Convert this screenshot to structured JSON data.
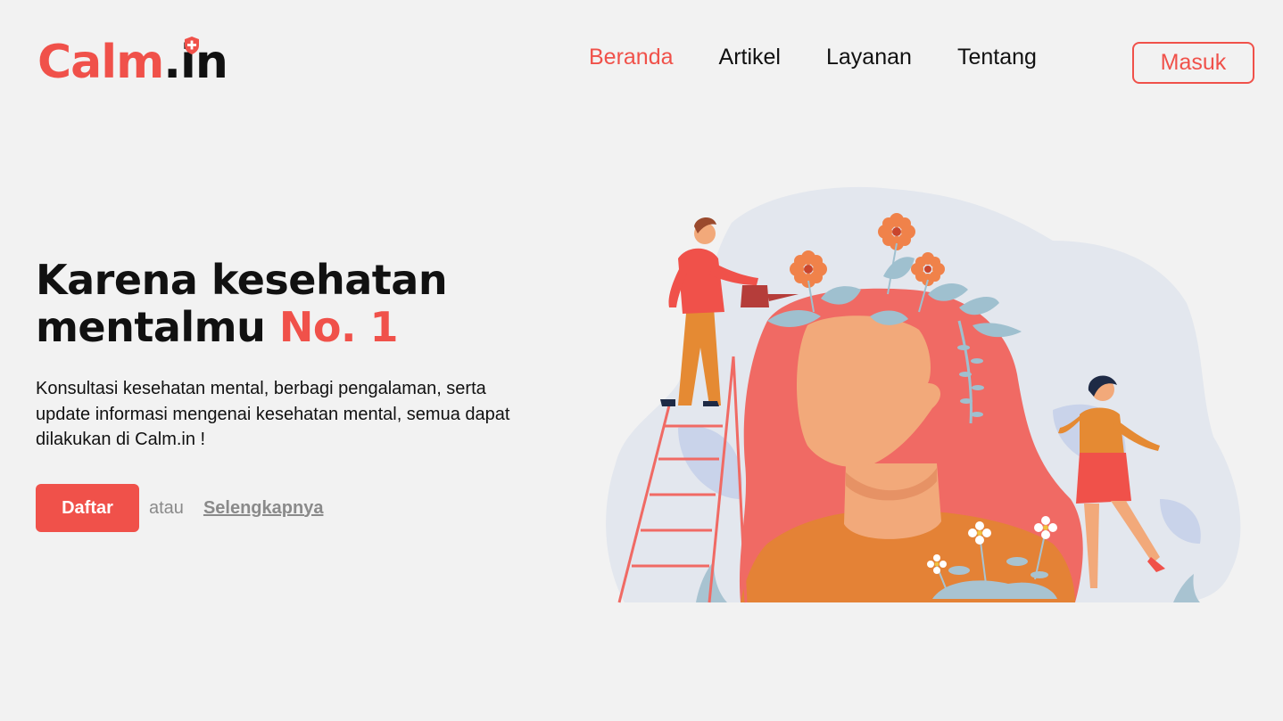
{
  "brand": {
    "name_main": "Calm",
    "name_dot": ".",
    "name_tld": "in"
  },
  "nav": {
    "items": [
      {
        "label": "Beranda",
        "active": true
      },
      {
        "label": "Artikel",
        "active": false
      },
      {
        "label": "Layanan",
        "active": false
      },
      {
        "label": "Tentang",
        "active": false
      }
    ],
    "login_label": "Masuk"
  },
  "hero": {
    "title_line1": "Karena kesehatan",
    "title_line2": "mentalmu",
    "title_accent": "No. 1",
    "description": "Konsultasi kesehatan mental, berbagi pengalaman, serta update informasi mengenai kesehatan mental, semua dapat dilakukan di Calm.in !",
    "primary_button": "Daftar",
    "or_text": "atau",
    "more_link": "Selengkapnya"
  },
  "colors": {
    "accent": "#f0514a",
    "background": "#f2f2f2",
    "text": "#111111"
  },
  "icons": {
    "logo_badge": "shield-plus-icon"
  }
}
